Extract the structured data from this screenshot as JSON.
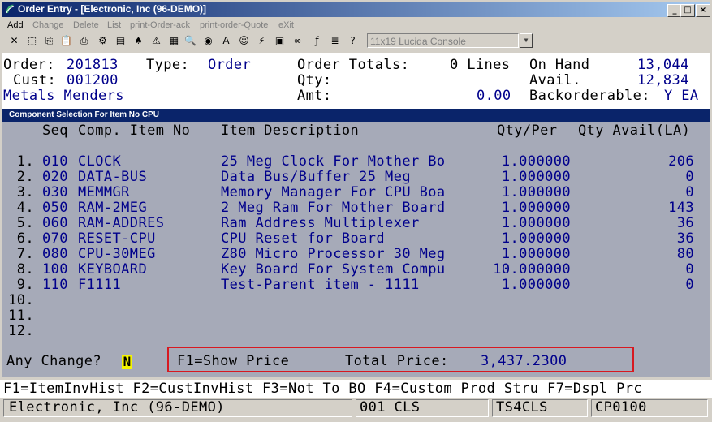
{
  "window": {
    "title": "Order Entry - [Electronic, Inc (96-DEMO)]",
    "buttons": {
      "minimize": "_",
      "maximize": "□",
      "close": "×"
    }
  },
  "menu": [
    {
      "label": "Add",
      "enabled": true
    },
    {
      "label": "Change",
      "enabled": false
    },
    {
      "label": "Delete",
      "enabled": false
    },
    {
      "label": "List",
      "enabled": false
    },
    {
      "label": "print-Order-ack",
      "enabled": false
    },
    {
      "label": "print-order-Quote",
      "enabled": false
    },
    {
      "label": "eXit",
      "enabled": false
    }
  ],
  "toolbar": {
    "icons": [
      "close-icon",
      "select-icon",
      "copy-icon",
      "paste-icon",
      "print-icon",
      "settings-icon",
      "note-icon",
      "user-icon",
      "warning-icon",
      "grid-icon",
      "search-icon",
      "globe-icon",
      "font-icon",
      "person-icon",
      "lightning-icon",
      "calculator-icon",
      "link-icon",
      "function-icon",
      "list-icon",
      "help-pointer-icon"
    ],
    "glyphs": [
      "✕",
      "⬚",
      "⎘",
      "📋",
      "⎙",
      "⚙",
      "▤",
      "♠",
      "⚠",
      "▦",
      "🔍",
      "◉",
      "A",
      "☺",
      "⚡",
      "▣",
      "∞",
      "ƒ",
      "≣",
      "?"
    ],
    "font_value": "11x19 Lucida Console"
  },
  "header": {
    "order_label": "Order:",
    "order_value": "201813",
    "type_label": "Type:",
    "type_value": "Order",
    "totals_label": "Order Totals:",
    "lines_value": "0 Lines",
    "onhand_label": "On Hand",
    "onhand_value": "13,044",
    "cust_label": "Cust:",
    "cust_value": "001200",
    "qty_label": "Qty:",
    "avail_label": "Avail.",
    "avail_value": "12,834",
    "customer_name": "Metals Menders",
    "amt_label": "Amt:",
    "amt_value": "0.00",
    "backorder_label": "Backorderable:",
    "backorder_value": "Y EA"
  },
  "panel": {
    "title": "Component Selection For Item No CPU",
    "columns": [
      "Seq",
      "Comp. Item No",
      "Item Description",
      "Qty/Per",
      "Qty Avail(LA)"
    ],
    "rows": [
      {
        "num": "1.",
        "seq": "010",
        "item": "CLOCK",
        "desc": "25 Meg Clock For Mother Bo",
        "qty": "1.000000",
        "avail": "206"
      },
      {
        "num": "2.",
        "seq": "020",
        "item": "DATA-BUS",
        "desc": "Data Bus/Buffer 25 Meg",
        "qty": "1.000000",
        "avail": "0"
      },
      {
        "num": "3.",
        "seq": "030",
        "item": "MEMMGR",
        "desc": "Memory Manager For CPU Boa",
        "qty": "1.000000",
        "avail": "0"
      },
      {
        "num": "4.",
        "seq": "050",
        "item": "RAM-2MEG",
        "desc": "2 Meg Ram For Mother Board",
        "qty": "1.000000",
        "avail": "143"
      },
      {
        "num": "5.",
        "seq": "060",
        "item": "RAM-ADDRES",
        "desc": "Ram Address Multiplexer",
        "qty": "1.000000",
        "avail": "36"
      },
      {
        "num": "6.",
        "seq": "070",
        "item": "RESET-CPU",
        "desc": "CPU Reset for Board",
        "qty": "1.000000",
        "avail": "36"
      },
      {
        "num": "7.",
        "seq": "080",
        "item": "CPU-30MEG",
        "desc": "Z80 Micro Processor 30 Meg",
        "qty": "1.000000",
        "avail": "80"
      },
      {
        "num": "8.",
        "seq": "100",
        "item": "KEYBOARD",
        "desc": "Key Board For System Compu",
        "qty": "10.000000",
        "avail": "0"
      },
      {
        "num": "9.",
        "seq": "110",
        "item": "F1111",
        "desc": "Test-Parent item - 1111",
        "qty": "1.000000",
        "avail": "0"
      },
      {
        "num": "10.",
        "seq": "",
        "item": "",
        "desc": "",
        "qty": "",
        "avail": ""
      },
      {
        "num": "11.",
        "seq": "",
        "item": "",
        "desc": "",
        "qty": "",
        "avail": ""
      },
      {
        "num": "12.",
        "seq": "",
        "item": "",
        "desc": "",
        "qty": "",
        "avail": ""
      }
    ],
    "prompt_label": "Any Change?",
    "prompt_value": "N",
    "show_price": "F1=Show Price",
    "total_price_label": "Total Price:",
    "total_price_value": "3,437.2300"
  },
  "fkeys": "F1=ItemInvHist F2=CustInvHist F3=Not To BO F4=Custom Prod Stru F7=Dspl Prc",
  "status": {
    "company": "Electronic, Inc (96-DEMO)",
    "code": "001 CLS",
    "terminal": "TS4CLS",
    "program": "CP0100"
  },
  "colors": {
    "title_start": "#0a246a",
    "panel_bg": "#a6aab8",
    "value_text": "#00008b",
    "highlight_border": "#d71920",
    "prompt_bg": "#f5f500"
  }
}
